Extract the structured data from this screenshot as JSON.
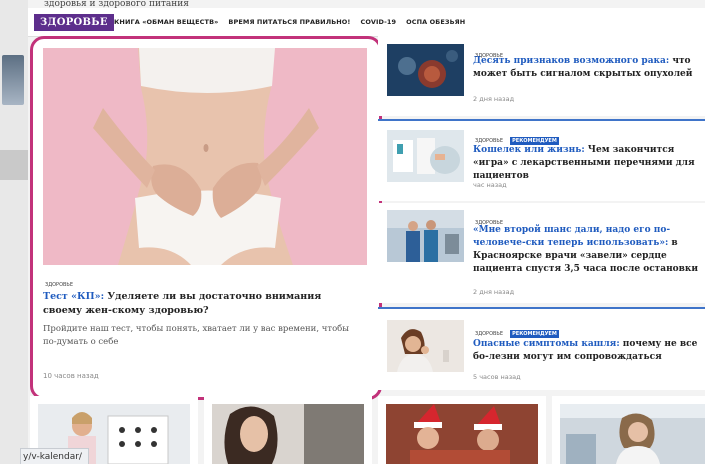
{
  "background_top_text": "здоровья и здорового питания",
  "header": {
    "section": "ЗДОРОВЬЕ",
    "nav": [
      "КНИГА «ОБМАН ВЕЩЕСТВ»",
      "ВРЕМЯ ПИТАТЬСЯ ПРАВИЛЬНО!",
      "COVID-19",
      "ОСПА ОБЕЗЬЯН"
    ]
  },
  "featured": {
    "tag": "ЗДОРОВЬЕ",
    "title_highlight": "Тест «КП»:",
    "title_rest": " Уделяете ли вы достаточно внимания своему жен-скому здоровью?",
    "lead": "Пройдите наш тест, чтобы понять, хватает ли у вас времени, чтобы по-думать о себе",
    "time": "10 часов назад"
  },
  "articles": [
    {
      "tags": [
        "ЗДОРОВЬЕ"
      ],
      "title_highlight": "Десять признаков возможного рака:",
      "title_rest": " что может быть сигналом скрытых опухолей",
      "time": "2 дня назад"
    },
    {
      "tags": [
        "ЗДОРОВЬЕ",
        "РЕКОМЕНДУЕМ"
      ],
      "title_highlight": "Кошелек или жизнь:",
      "title_rest": " Чем закончится «игра» с лекарственными перечнями для пациентов",
      "time": "час назад"
    },
    {
      "tags": [
        "ЗДОРОВЬЕ"
      ],
      "title_highlight": "«Мне второй шанс дали, надо его по-человече-ски теперь использовать»:",
      "title_rest": " в Красноярске врачи «завели» сердце пациента спустя 3,5 часа после остановки",
      "time": "2 дня назад"
    },
    {
      "tags": [
        "ЗДОРОВЬЕ",
        "РЕКОМЕНДУЕМ"
      ],
      "title_highlight": "Опасные симптомы кашля:",
      "title_rest": " почему не все бо-лезни могут им сопровождаться",
      "time": "5 часов назад"
    }
  ],
  "status_url": "y/v-kalendar/"
}
